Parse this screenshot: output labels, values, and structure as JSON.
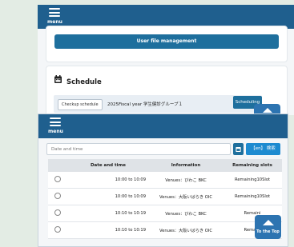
{
  "top_panel": {
    "menu_label": "menu",
    "user_file_button": "User file management",
    "schedule_title": "Schedule",
    "schedule_row": {
      "chip": "Checkup schedule",
      "text": "2025Fiscal year 学生健診グループ１",
      "button": "Scheduling"
    }
  },
  "bottom_panel": {
    "menu_label": "menu",
    "cut_label": "...",
    "date_placeholder": "Date and time",
    "en_button": "【en】 検索",
    "to_top_label": "To the Top",
    "table": {
      "headers": [
        "",
        "Date and time",
        "Information",
        "Remaining slots"
      ],
      "rows": [
        {
          "time": "10:00 to 10:09",
          "info": "Venues：びわこ BKC",
          "slots": "Remaining10Slot"
        },
        {
          "time": "10:00 to 10:09",
          "info": "Venues：大阪いばらき OIC",
          "slots": "Remaining10Slot"
        },
        {
          "time": "10:10 to 10:19",
          "info": "Venues：びわこ BKC",
          "slots": "Remaini"
        },
        {
          "time": "10:10 to 10:19",
          "info": "Venues：大阪いばらき OIC",
          "slots": "Remaini"
        }
      ]
    }
  },
  "colors": {
    "topbar": "#1f5f8e",
    "primary_button": "#1e6f9d",
    "scroll_top": "#2d74b1"
  }
}
